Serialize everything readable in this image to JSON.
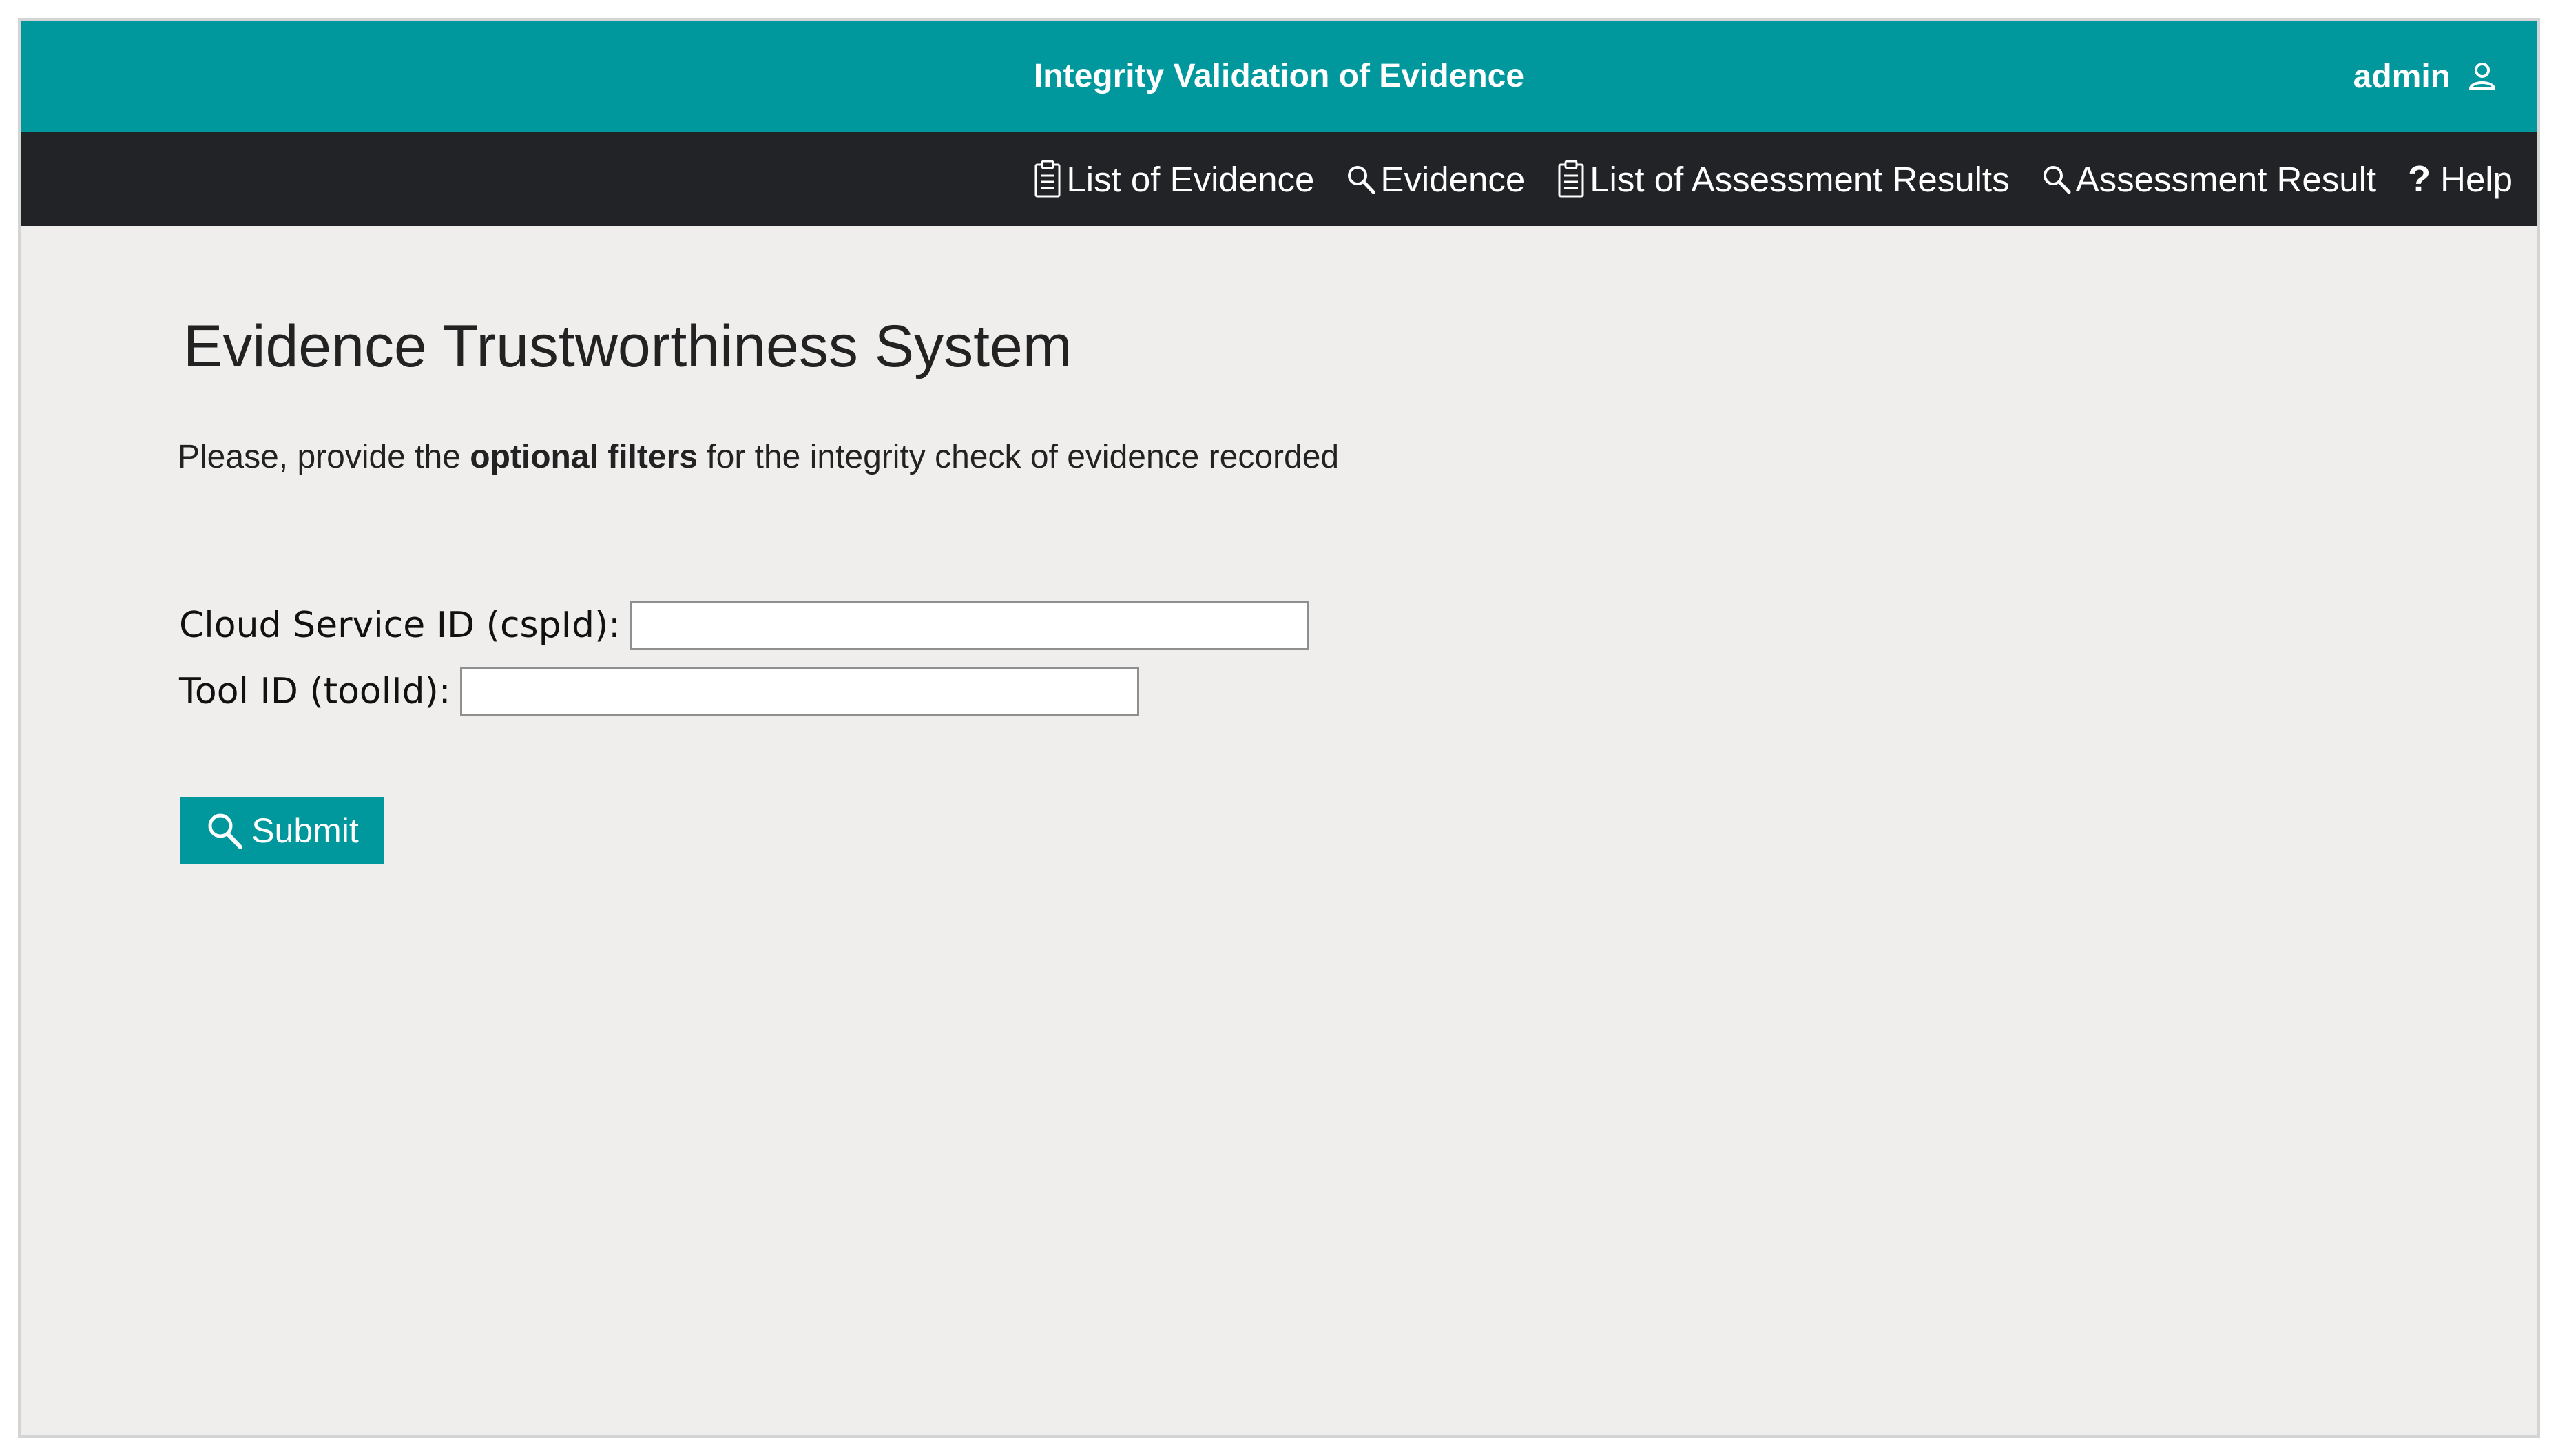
{
  "header": {
    "title": "Integrity Validation of Evidence",
    "user": "admin",
    "user_icon": "user-icon"
  },
  "nav": {
    "items": [
      {
        "label": "List of Evidence",
        "icon": "clipboard-icon"
      },
      {
        "label": "Evidence",
        "icon": "search-icon"
      },
      {
        "label": "List of Assessment Results",
        "icon": "clipboard-icon"
      },
      {
        "label": "Assessment Result",
        "icon": "search-icon"
      },
      {
        "label": "Help",
        "icon": "question-icon",
        "glyph": "?"
      }
    ]
  },
  "main": {
    "title": "Evidence Trustworthiness System",
    "intro_before": "Please, provide the ",
    "intro_bold": "optional filters",
    "intro_after": " for the integrity check of evidence recorded",
    "fields": [
      {
        "label": "Cloud Service ID (cspId):",
        "value": "",
        "placeholder": ""
      },
      {
        "label": "Tool ID (toolId):",
        "value": "",
        "placeholder": ""
      }
    ],
    "submit_label": "Submit",
    "submit_icon": "search-icon"
  },
  "colors": {
    "accent": "#00979d",
    "navbar": "#212327",
    "background": "#efeeed"
  }
}
